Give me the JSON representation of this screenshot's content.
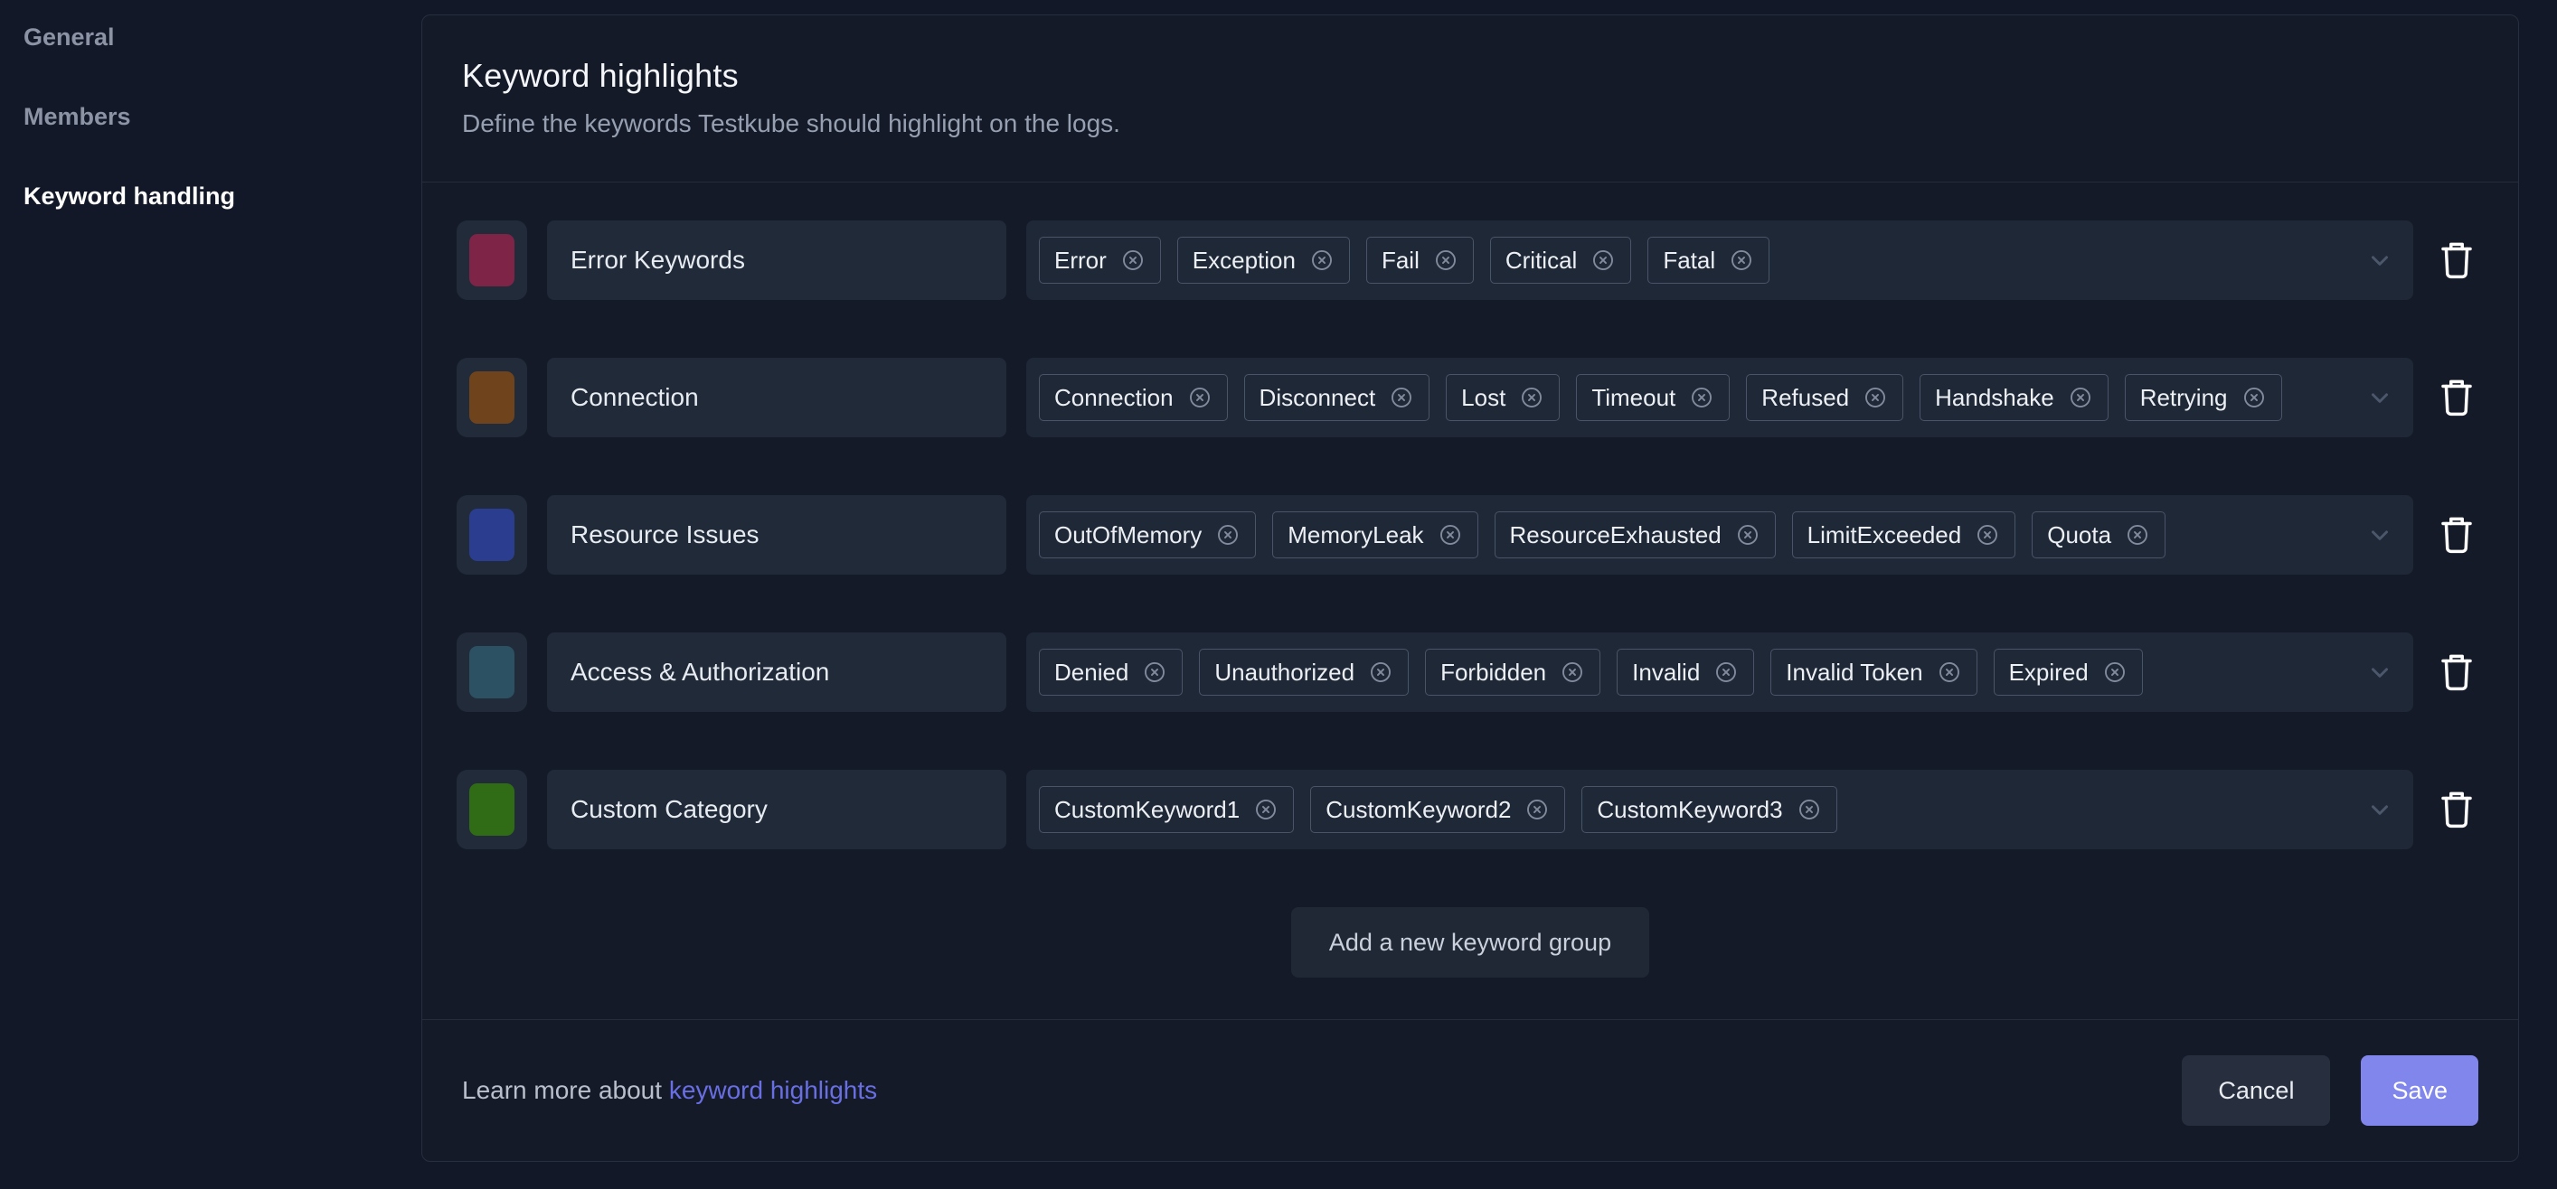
{
  "sidebar": {
    "items": [
      {
        "label": "General",
        "active": false
      },
      {
        "label": "Members",
        "active": false
      },
      {
        "label": "Keyword handling",
        "active": true
      }
    ]
  },
  "header": {
    "title": "Keyword highlights",
    "subtitle": "Define the keywords Testkube should highlight on the logs."
  },
  "groups": [
    {
      "name": "Error Keywords",
      "color": "#7d2447",
      "keywords": [
        "Error",
        "Exception",
        "Fail",
        "Critical",
        "Fatal"
      ]
    },
    {
      "name": "Connection",
      "color": "#6f431c",
      "keywords": [
        "Connection",
        "Disconnect",
        "Lost",
        "Timeout",
        "Refused",
        "Handshake",
        "Retrying"
      ]
    },
    {
      "name": "Resource Issues",
      "color": "#2b3d8f",
      "keywords": [
        "OutOfMemory",
        "MemoryLeak",
        "ResourceExhausted",
        "LimitExceeded",
        "Quota"
      ]
    },
    {
      "name": "Access & Authorization",
      "color": "#2c5163",
      "keywords": [
        "Denied",
        "Unauthorized",
        "Forbidden",
        "Invalid",
        "Invalid Token",
        "Expired"
      ]
    },
    {
      "name": "Custom Category",
      "color": "#2f6c15",
      "keywords": [
        "CustomKeyword1",
        "CustomKeyword2",
        "CustomKeyword3"
      ]
    }
  ],
  "add_button": {
    "label": "Add a new keyword group"
  },
  "footer": {
    "learn_more_prefix": "Learn more about ",
    "learn_more_link": "keyword highlights",
    "cancel_label": "Cancel",
    "save_label": "Save"
  },
  "colors": {
    "accent": "#8186ec",
    "link": "#696ee3"
  }
}
